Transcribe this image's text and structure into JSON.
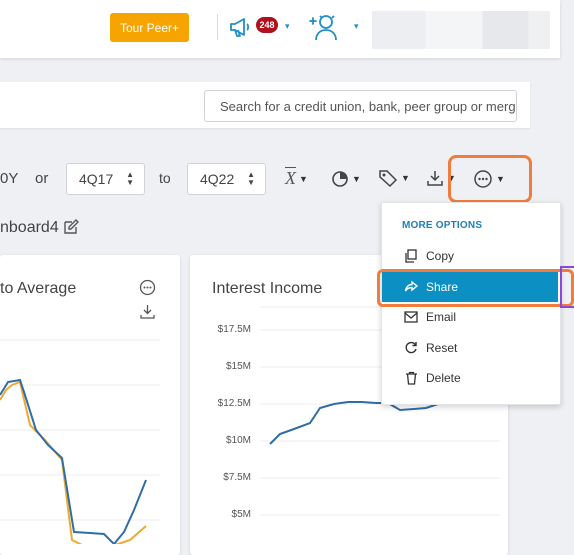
{
  "header": {
    "tour_button": "Tour Peer+",
    "notification_count": "248"
  },
  "search": {
    "placeholder": "Search for a credit union, bank, peer group or merger"
  },
  "filters": {
    "period_tail": "0Y",
    "or_label": "or",
    "from_value": "4Q17",
    "to_label": "to",
    "to_value": "4Q22"
  },
  "dashboard": {
    "name": "nboard4"
  },
  "cards": {
    "left_title": "to Average",
    "right_title": "Interest Income",
    "right_yticks": [
      "$17.5M",
      "$15M",
      "$12.5M",
      "$10M",
      "$7.5M",
      "$5M"
    ]
  },
  "menu": {
    "header": "MORE OPTIONS",
    "items": [
      {
        "label": "Copy",
        "icon": "copy-icon"
      },
      {
        "label": "Share",
        "icon": "share-icon"
      },
      {
        "label": "Email",
        "icon": "email-icon"
      },
      {
        "label": "Reset",
        "icon": "reset-icon"
      },
      {
        "label": "Delete",
        "icon": "trash-icon"
      }
    ],
    "active_item": "Share"
  },
  "colors": {
    "tour_button": "#f7a400",
    "menu_active": "#0c8fc2",
    "highlight_outline": "#f07c3e",
    "series_blue": "#2f6ea5",
    "series_orange": "#f0a830",
    "purple_marker": "#8b47d6"
  }
}
